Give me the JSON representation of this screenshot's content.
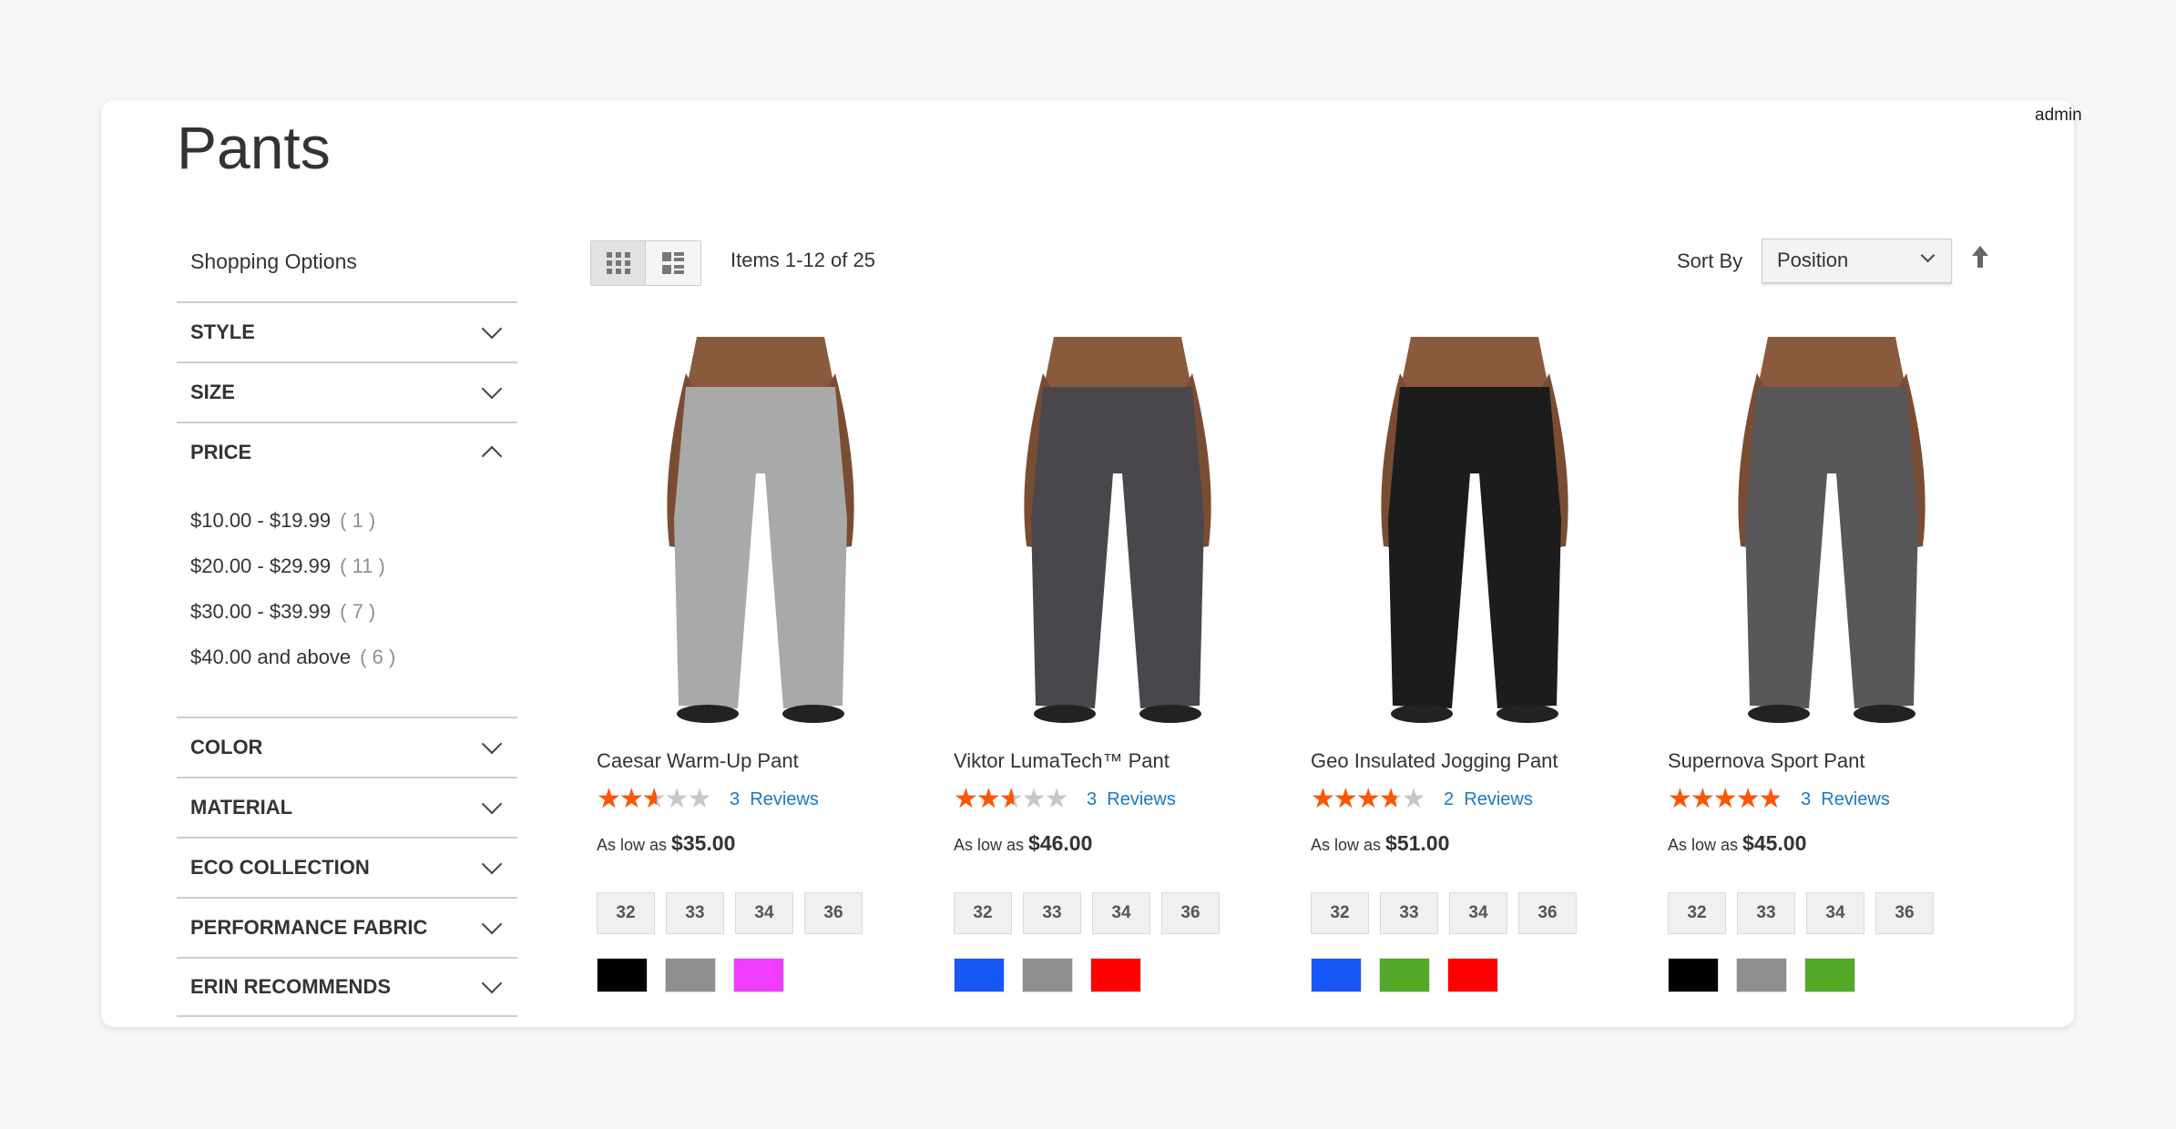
{
  "header": {
    "user": "admin",
    "title": "Pants"
  },
  "sidebar": {
    "title": "Shopping Options",
    "filters_top": [
      {
        "label": "STYLE"
      },
      {
        "label": "SIZE"
      }
    ],
    "price": {
      "label": "PRICE",
      "options": [
        {
          "range": "$10.00 - $19.99",
          "count": "( 1 )"
        },
        {
          "range": "$20.00 - $29.99",
          "count": "( 11 )"
        },
        {
          "range": "$30.00 - $39.99",
          "count": "( 7 )"
        },
        {
          "range": "$40.00 and above",
          "count": "( 6 )"
        }
      ]
    },
    "filters_bottom": [
      {
        "label": "COLOR"
      },
      {
        "label": "MATERIAL"
      },
      {
        "label": "ECO COLLECTION"
      },
      {
        "label": "PERFORMANCE FABRIC"
      },
      {
        "label": "ERIN RECOMMENDS"
      }
    ]
  },
  "toolbar": {
    "items_text": "Items 1-12 of 25",
    "sort_label": "Sort By",
    "sort_value": "Position",
    "view_mode": "grid"
  },
  "products": [
    {
      "name": "Caesar Warm-Up Pant",
      "rating_percent": 47,
      "reviews_count": "3",
      "reviews_label": "Reviews",
      "price_prefix": "As low as",
      "price": "$35.00",
      "pant_color": "#a9a9a9",
      "sizes": [
        "32",
        "33",
        "34",
        "36"
      ],
      "colors": [
        "#000000",
        "#8f8f8f",
        "#ef3dff"
      ]
    },
    {
      "name": "Viktor LumaTech™ Pant",
      "rating_percent": 47,
      "reviews_count": "3",
      "reviews_label": "Reviews",
      "price_prefix": "As low as",
      "price": "$46.00",
      "pant_color": "#4a474c",
      "sizes": [
        "32",
        "33",
        "34",
        "36"
      ],
      "colors": [
        "#1857f7",
        "#8f8f8f",
        "#ff0000"
      ]
    },
    {
      "name": "Geo Insulated Jogging Pant",
      "rating_percent": 67,
      "reviews_count": "2",
      "reviews_label": "Reviews",
      "price_prefix": "As low as",
      "price": "$51.00",
      "pant_color": "#1c1c1c",
      "sizes": [
        "32",
        "33",
        "34",
        "36"
      ],
      "colors": [
        "#1857f7",
        "#53a828",
        "#ff0000"
      ]
    },
    {
      "name": "Supernova Sport Pant",
      "rating_percent": 87,
      "reviews_count": "3",
      "reviews_label": "Reviews",
      "price_prefix": "As low as",
      "price": "$45.00",
      "pant_color": "#58585a",
      "sizes": [
        "32",
        "33",
        "34",
        "36"
      ],
      "colors": [
        "#000000",
        "#8f8f8f",
        "#53a828"
      ]
    }
  ],
  "colors": {
    "star": "#ff5501",
    "link": "#1979c3"
  }
}
